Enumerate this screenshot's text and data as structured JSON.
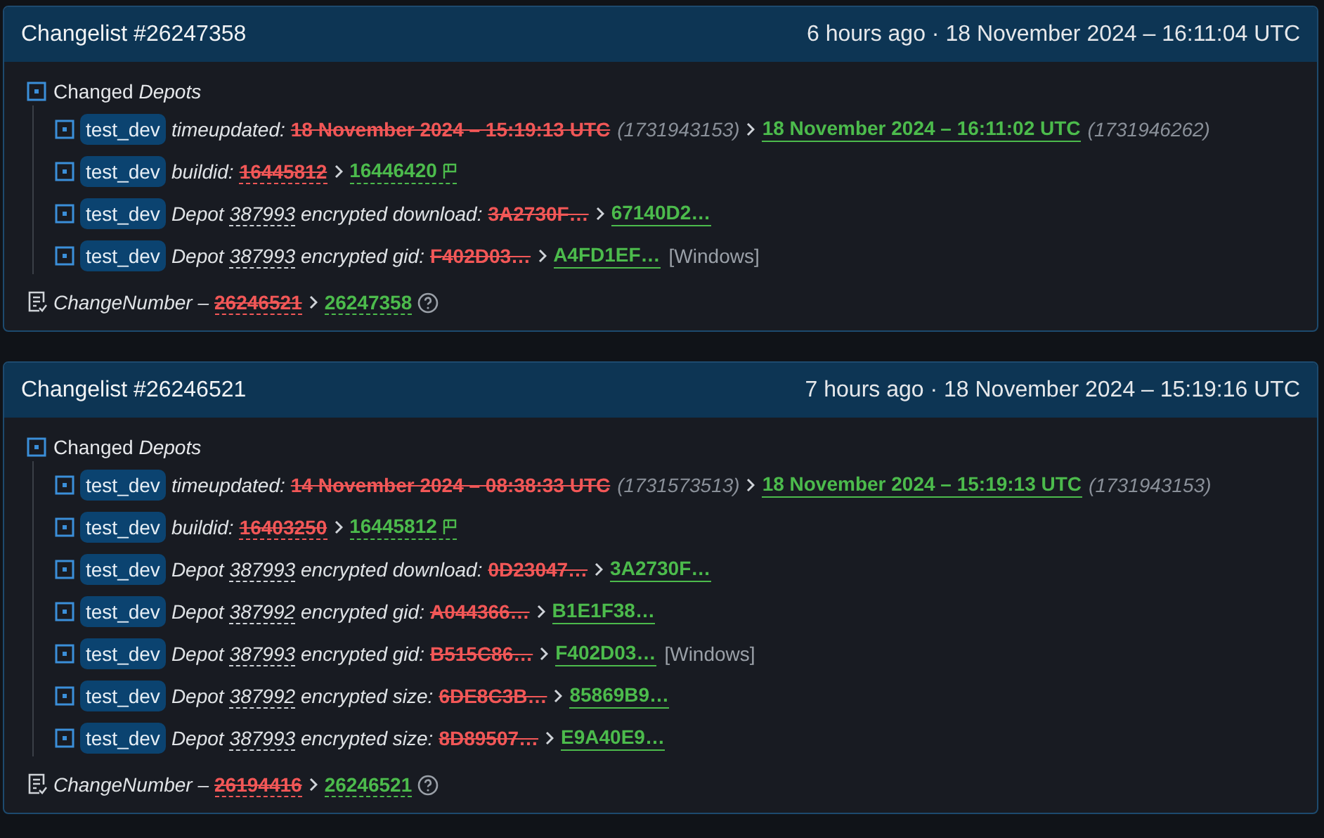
{
  "changelists": [
    {
      "title": "Changelist #26247358",
      "time": "6 hours ago · 18 November 2024 – 16:11:04 UTC",
      "section": "Changed *Depots*",
      "rows": [
        {
          "kind": "time",
          "tag": "test_dev",
          "field": "timeupdated:",
          "old": "18 November 2024 – 15:19:13 UTC",
          "old_note": "(1731943153)",
          "new": "18 November 2024 – 16:11:02 UTC",
          "new_note": "(1731946262)"
        },
        {
          "kind": "build",
          "tag": "test_dev",
          "field": "buildid:",
          "old": "16445812",
          "new": "16446420"
        },
        {
          "kind": "hash",
          "tag": "test_dev",
          "depot_label": "Depot",
          "depot": "387993",
          "field": "encrypted download:",
          "old": "3A2730F…",
          "new": "67140D2…"
        },
        {
          "kind": "hash",
          "tag": "test_dev",
          "depot_label": "Depot",
          "depot": "387993",
          "field": "encrypted gid:",
          "old": "F402D03…",
          "new": "A4FD1EF…",
          "suffix": "[Windows]"
        }
      ],
      "change_label": "ChangeNumber –",
      "change_old": "26246521",
      "change_new": "26247358"
    },
    {
      "title": "Changelist #26246521",
      "time": "7 hours ago · 18 November 2024 – 15:19:16 UTC",
      "section": "Changed *Depots*",
      "rows": [
        {
          "kind": "time",
          "tag": "test_dev",
          "field": "timeupdated:",
          "old": "14 November 2024 – 08:38:33 UTC",
          "old_note": "(1731573513)",
          "new": "18 November 2024 – 15:19:13 UTC",
          "new_note": "(1731943153)"
        },
        {
          "kind": "build",
          "tag": "test_dev",
          "field": "buildid:",
          "old": "16403250",
          "new": "16445812"
        },
        {
          "kind": "hash",
          "tag": "test_dev",
          "depot_label": "Depot",
          "depot": "387993",
          "field": "encrypted download:",
          "old": "0D23047…",
          "new": "3A2730F…"
        },
        {
          "kind": "hash",
          "tag": "test_dev",
          "depot_label": "Depot",
          "depot": "387992",
          "field": "encrypted gid:",
          "old": "A044366…",
          "new": "B1E1F38…"
        },
        {
          "kind": "hash",
          "tag": "test_dev",
          "depot_label": "Depot",
          "depot": "387993",
          "field": "encrypted gid:",
          "old": "B515C86…",
          "new": "F402D03…",
          "suffix": "[Windows]"
        },
        {
          "kind": "hash",
          "tag": "test_dev",
          "depot_label": "Depot",
          "depot": "387992",
          "field": "encrypted size:",
          "old": "6DE8C3B…",
          "new": "85869B9…"
        },
        {
          "kind": "hash",
          "tag": "test_dev",
          "depot_label": "Depot",
          "depot": "387993",
          "field": "encrypted size:",
          "old": "8D89507…",
          "new": "E9A40E9…"
        }
      ],
      "change_label": "ChangeNumber –",
      "change_old": "26194416",
      "change_new": "26246521"
    }
  ]
}
